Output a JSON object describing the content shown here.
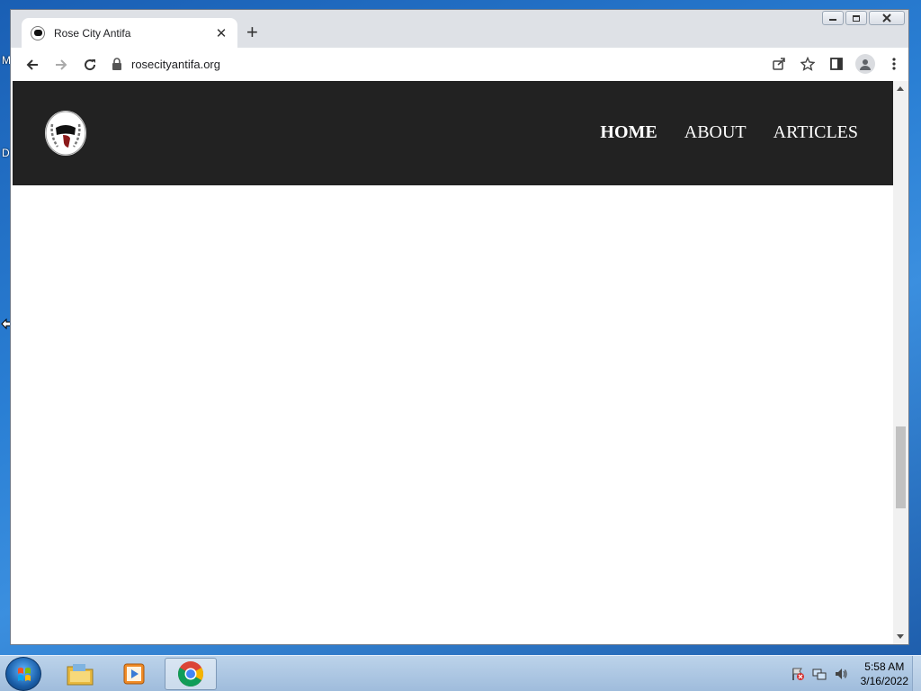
{
  "desktop": {
    "letters": [
      "M",
      "D"
    ]
  },
  "browser": {
    "tab": {
      "title": "Rose City Antifa",
      "favicon": "antifa-flag-icon"
    },
    "toolbar": {
      "url": "rosecityantifa.org",
      "icons": [
        "back-arrow-icon",
        "forward-arrow-icon",
        "reload-icon",
        "lock-icon",
        "share-icon",
        "bookmark-star-icon",
        "side-panel-icon",
        "profile-icon",
        "kebab-menu-icon"
      ]
    },
    "window_controls": [
      "minimize-icon",
      "restore-icon",
      "close-icon"
    ]
  },
  "site": {
    "nav": [
      {
        "label": "HOME",
        "active": true
      },
      {
        "label": "ABOUT",
        "active": false
      },
      {
        "label": "ARTICLES",
        "active": false
      }
    ],
    "colors": {
      "header_bg": "#222222",
      "nav_text": "#ffffff",
      "logo_red": "#8b1a1a"
    }
  },
  "taskbar": {
    "items": [
      "file-explorer-icon",
      "media-player-icon",
      "chrome-icon"
    ],
    "active_item": "chrome-icon",
    "clock": {
      "time": "5:58 AM",
      "date": "3/16/2022"
    }
  }
}
